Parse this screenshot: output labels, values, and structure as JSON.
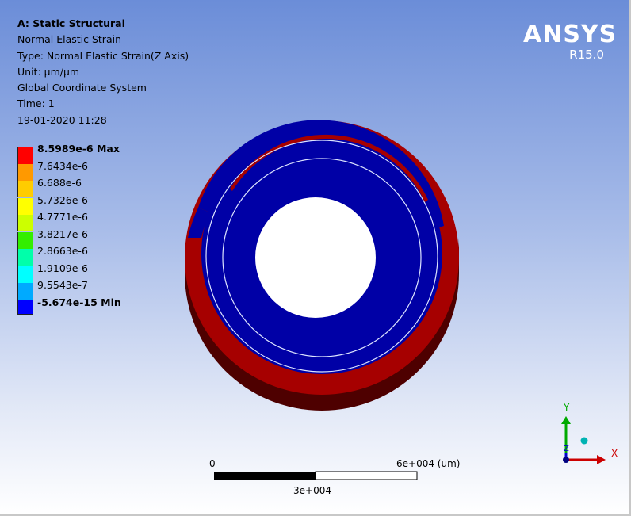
{
  "header": {
    "title": "A: Static Structural",
    "result": "Normal Elastic Strain",
    "type": "Type: Normal Elastic Strain(Z Axis)",
    "unit": "Unit: µm/µm",
    "coord": "Global Coordinate System",
    "time": "Time: 1",
    "date": "19-01-2020 11:28"
  },
  "legend": {
    "max_label": "8.5989e-6 Max",
    "min_label": "-5.674e-15 Min",
    "labels": [
      "8.5989e-6 Max",
      "7.6434e-6",
      "6.688e-6",
      "5.7326e-6",
      "4.7771e-6",
      "3.8217e-6",
      "2.8663e-6",
      "1.9109e-6",
      "9.5543e-7",
      "-5.674e-15 Min"
    ],
    "colors": [
      "#ff0000",
      "#ff9900",
      "#ffcc00",
      "#ffff00",
      "#ccff00",
      "#33ee00",
      "#00ffaa",
      "#00ffff",
      "#00aaff",
      "#0000ff"
    ]
  },
  "logo": {
    "brand": "ANSYS",
    "version": "R15.0"
  },
  "scale_bar": {
    "start": "0",
    "end": "6e+004 (um)",
    "mid": "3e+004"
  },
  "triad": {
    "x": "X",
    "y": "Y",
    "z": "Z"
  },
  "model_colors": {
    "strain_max": "#a60000",
    "strain_min": "#0000a6",
    "side_shadow": "#5a0000"
  }
}
